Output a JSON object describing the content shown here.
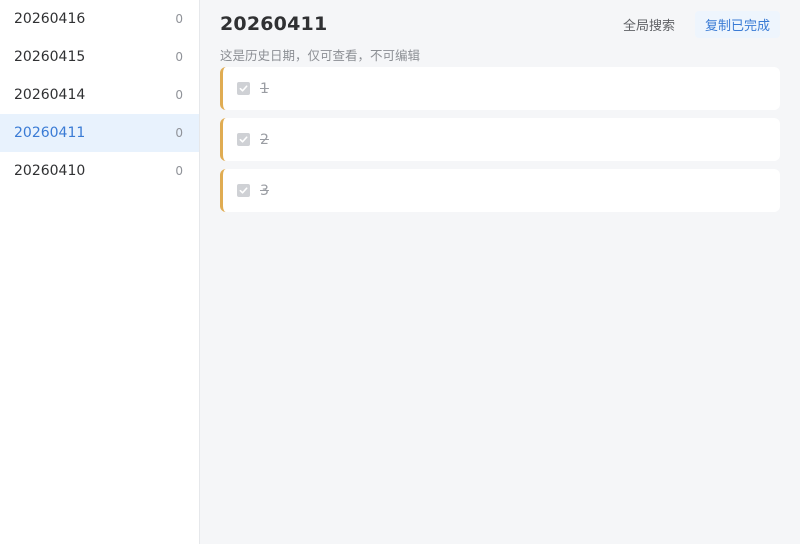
{
  "sidebar": {
    "items": [
      {
        "date": "20260416",
        "count": "0",
        "active": false
      },
      {
        "date": "20260415",
        "count": "0",
        "active": false
      },
      {
        "date": "20260414",
        "count": "0",
        "active": false
      },
      {
        "date": "20260411",
        "count": "0",
        "active": true
      },
      {
        "date": "20260410",
        "count": "0",
        "active": false
      }
    ]
  },
  "header": {
    "title": "20260411",
    "search_label": "全局搜索",
    "copy_label": "复制已完成"
  },
  "subtitle": "这是历史日期，仅可查看，不可编辑",
  "tasks": [
    {
      "text": "1",
      "checked": true
    },
    {
      "text": "2",
      "checked": true
    },
    {
      "text": "3",
      "checked": true
    }
  ],
  "colors": {
    "accent": "#3a7bd5",
    "active_bg": "#e8f2fd",
    "task_border": "#e0ac52",
    "main_bg": "#f5f6f8"
  }
}
